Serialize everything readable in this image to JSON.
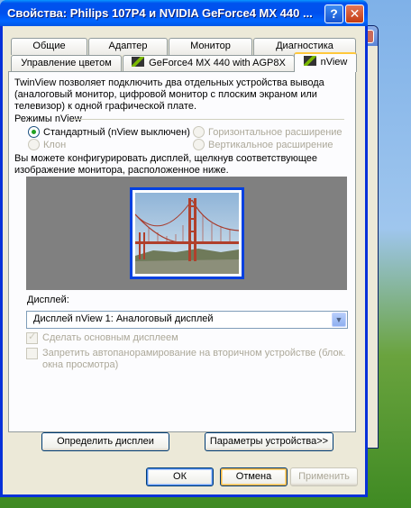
{
  "window": {
    "title": "Свойства: Philips 107P4 и NVIDIA GeForce4 MX 440 ...",
    "help_label": "?",
    "close_label": "✕"
  },
  "tabs_row1": [
    "Общие",
    "Адаптер",
    "Монитор",
    "Диагностика"
  ],
  "tabs_row2": [
    "Управление цветом",
    "GeForce4 MX 440 with AGP8X",
    "nView"
  ],
  "panel": {
    "intro": "TwinView позволяет подключить два отдельных устройства вывода (аналоговый монитор, цифровой монитор с плоским экраном или телевизор) к одной графической плате.",
    "modes_title": "Режимы nView",
    "radios": {
      "standard": "Стандартный (nView выключен)",
      "horizontal": "Горизонтальное расширение",
      "clone": "Клон",
      "vertical": "Вертикальное расширение"
    },
    "description": "Вы можете конфигурировать дисплей, щелкнув соответствующее изображение монитора, расположенное ниже.",
    "display_label": "Дисплей:",
    "display_value": "Дисплей nView 1: Аналоговый дисплей",
    "check_primary": "Сделать основным дисплеем",
    "check_autopan": "Запретить автопанорамирование на вторичном устройстве (блок. окна просмотра)",
    "identify_button": "Определить дисплеи",
    "device_settings_button": "Параметры устройства>>"
  },
  "buttons": {
    "ok": "ОК",
    "cancel": "Отмена",
    "apply": "Применить"
  },
  "colors": {
    "title_blue": "#0053ee",
    "dialog_bg": "#ece9d8",
    "active_tab_accent": "#ffc83c",
    "display_area": "#808080",
    "monitor_border": "#0040e0"
  }
}
